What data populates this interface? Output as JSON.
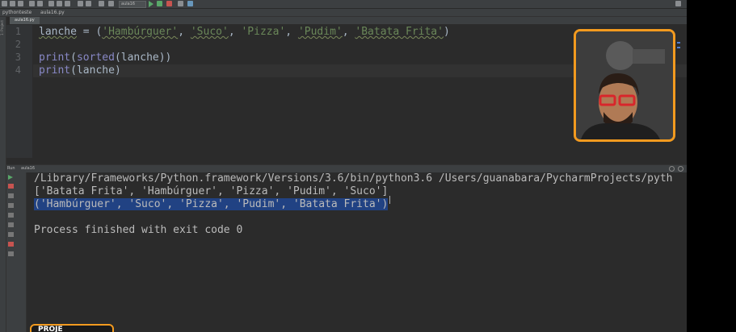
{
  "toolbar": {
    "run_config": "aula16",
    "icons": [
      "folder-icon",
      "save-icon",
      "sync-icon",
      "back-icon",
      "forward-icon",
      "cut-icon",
      "copy-icon",
      "paste-icon",
      "search-icon",
      "replace-icon",
      "build-icon",
      "run-icon",
      "debug-icon",
      "stop-icon",
      "settings-icon",
      "help-icon"
    ]
  },
  "navbar": {
    "project": "pythonteste",
    "file": "aula16.py"
  },
  "editor_tab": {
    "label": "aula16.py"
  },
  "editor": {
    "line_numbers": [
      "1",
      "2",
      "3",
      "4"
    ],
    "line1": {
      "var": "lanche",
      "op": " = (",
      "s1": "'Hambúrguer'",
      "s2": "'Suco'",
      "s3": "'Pizza'",
      "s4": "'Pudim'",
      "s5": "'Batata Frita'",
      "close": ")",
      "sep": ", "
    },
    "line3": {
      "fn": "print",
      "open": "(",
      "fn2": "sorted",
      "open2": "(",
      "arg": "lanche",
      "close": "))"
    },
    "line4": {
      "fn": "print",
      "open": "(",
      "arg": "lanche",
      "close": ")"
    }
  },
  "run_panel": {
    "header": "Run",
    "tab": "aula16",
    "console_lines": [
      "/Library/Frameworks/Python.framework/Versions/3.6/bin/python3.6 /Users/guanabara/PycharmProjects/pyth",
      "['Batata Frita', 'Hambúrguer', 'Pizza', 'Pudim', 'Suco']",
      "('Hambúrguer', 'Suco', 'Pizza', 'Pudim', 'Batata Frita')",
      "Process finished with exit code 0"
    ]
  },
  "overlay": {
    "badge": "PROJE",
    "accent": "#f29a1f"
  }
}
